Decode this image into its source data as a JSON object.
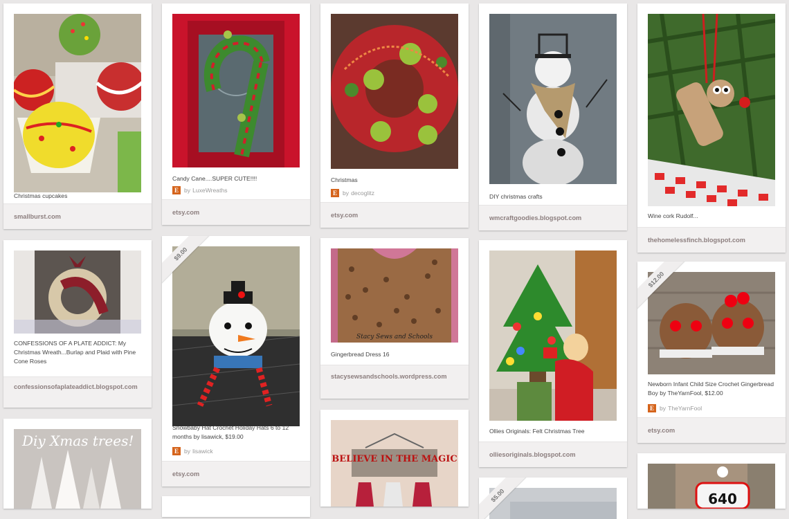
{
  "pins": [
    {
      "description": "Christmas cupcakes",
      "source": "smallburst.com"
    },
    {
      "description": "Candy Cane....SUPER CUTE!!!!",
      "by_label": "by",
      "attribution": "LuxeWreaths",
      "source": "etsy.com"
    },
    {
      "description": "Christmas",
      "by_label": "by",
      "attribution": "decoglitz",
      "source": "etsy.com"
    },
    {
      "description": "DIY christmas crafts",
      "source": "wmcraftgoodies.blogspot.com"
    },
    {
      "description": "Wine cork Rudolf...",
      "source": "thehomelessfinch.blogspot.com"
    },
    {
      "description": "CONFESSIONS OF A PLATE ADDICT: My Christmas Wreath...Burlap and Plaid with Pine Cone Roses",
      "source": "confessionsofaplateaddict.blogspot.com"
    },
    {
      "price": "$9.00",
      "description": "Snowbaby Hat Crochet Holiday Hats 6 to 12 months by lisawick, $19.00",
      "by_label": "by",
      "attribution": "lisawick",
      "source": "etsy.com"
    },
    {
      "description": "Gingerbread Dress 16",
      "image_caption": "Stacy Sews and Schools",
      "source": "stacysewsandschools.wordpress.com"
    },
    {
      "description": "Ollies Originals: Felt Christmas Tree",
      "source": "olliesoriginals.blogspot.com"
    },
    {
      "price": "$12.00",
      "description": "Newborn Infant Child Size Crochet Gingerbread Boy by TheYarnFool, $12.00",
      "by_label": "by",
      "attribution": "TheYarnFool",
      "source": "etsy.com"
    },
    {
      "image_text": "Diy Xmas trees!"
    },
    {
      "image_text": "BELIEVE IN THE MAGIC"
    },
    {
      "price": "$5.00"
    },
    {
      "image_text": "640"
    }
  ]
}
